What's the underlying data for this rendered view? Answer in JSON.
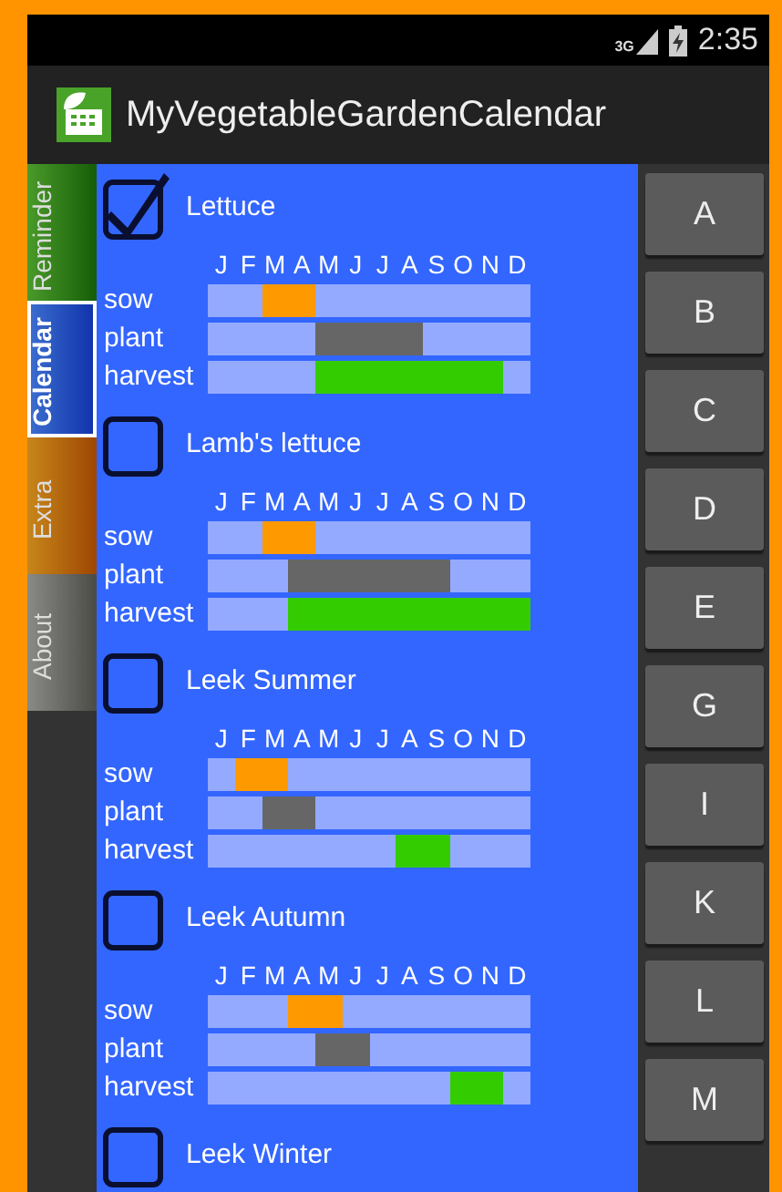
{
  "status_bar": {
    "network": "3G",
    "time": "2:35"
  },
  "action_bar": {
    "title": "MyVegetableGardenCalendar"
  },
  "side_tabs": [
    {
      "label": "Reminder",
      "selected": false,
      "color": "#4a9a2a"
    },
    {
      "label": "Calendar",
      "selected": true,
      "color": "#3d6fd0"
    },
    {
      "label": "Extra",
      "selected": false,
      "color": "#c8861a"
    },
    {
      "label": "About",
      "selected": false,
      "color": "#8a8a86"
    }
  ],
  "crops": [
    {
      "name": "Lettuce",
      "checked": true,
      "month_labels": [
        "J",
        "F",
        "M",
        "A",
        "M",
        "J",
        "J",
        "A",
        "S",
        "O",
        "N",
        "D"
      ],
      "rows": [
        {
          "label": "sow",
          "color": "#ff9900",
          "months": [
            false,
            false,
            true,
            true,
            false,
            false,
            false,
            false,
            false,
            false,
            false,
            false
          ]
        },
        {
          "label": "plant",
          "color": "#666666",
          "months": [
            false,
            false,
            false,
            false,
            true,
            true,
            true,
            true,
            false,
            false,
            false,
            false
          ]
        },
        {
          "label": "harvest",
          "color": "#33cc00",
          "months": [
            false,
            false,
            false,
            false,
            true,
            true,
            true,
            true,
            true,
            true,
            true,
            false
          ]
        }
      ]
    },
    {
      "name": "Lamb's lettuce",
      "checked": false,
      "month_labels": [
        "J",
        "F",
        "M",
        "A",
        "M",
        "J",
        "J",
        "A",
        "S",
        "O",
        "N",
        "D"
      ],
      "rows": [
        {
          "label": "sow",
          "color": "#ff9900",
          "months": [
            false,
            false,
            true,
            true,
            false,
            false,
            false,
            false,
            false,
            false,
            false,
            false
          ]
        },
        {
          "label": "plant",
          "color": "#666666",
          "months": [
            false,
            false,
            false,
            true,
            true,
            true,
            true,
            true,
            true,
            false,
            false,
            false
          ]
        },
        {
          "label": "harvest",
          "color": "#33cc00",
          "months": [
            false,
            false,
            false,
            true,
            true,
            true,
            true,
            true,
            true,
            true,
            true,
            true
          ]
        }
      ]
    },
    {
      "name": "Leek Summer",
      "checked": false,
      "month_labels": [
        "J",
        "F",
        "M",
        "A",
        "M",
        "J",
        "J",
        "A",
        "S",
        "O",
        "N",
        "D"
      ],
      "rows": [
        {
          "label": "sow",
          "color": "#ff9900",
          "months": [
            false,
            true,
            true,
            false,
            false,
            false,
            false,
            false,
            false,
            false,
            false,
            false
          ]
        },
        {
          "label": "plant",
          "color": "#666666",
          "months": [
            false,
            false,
            true,
            true,
            false,
            false,
            false,
            false,
            false,
            false,
            false,
            false
          ]
        },
        {
          "label": "harvest",
          "color": "#33cc00",
          "months": [
            false,
            false,
            false,
            false,
            false,
            false,
            false,
            true,
            true,
            false,
            false,
            false
          ]
        }
      ]
    },
    {
      "name": "Leek Autumn",
      "checked": false,
      "month_labels": [
        "J",
        "F",
        "M",
        "A",
        "M",
        "J",
        "J",
        "A",
        "S",
        "O",
        "N",
        "D"
      ],
      "rows": [
        {
          "label": "sow",
          "color": "#ff9900",
          "months": [
            false,
            false,
            false,
            true,
            true,
            false,
            false,
            false,
            false,
            false,
            false,
            false
          ]
        },
        {
          "label": "plant",
          "color": "#666666",
          "months": [
            false,
            false,
            false,
            false,
            true,
            true,
            false,
            false,
            false,
            false,
            false,
            false
          ]
        },
        {
          "label": "harvest",
          "color": "#33cc00",
          "months": [
            false,
            false,
            false,
            false,
            false,
            false,
            false,
            false,
            false,
            true,
            true,
            false
          ]
        }
      ]
    },
    {
      "name": "Leek Winter",
      "checked": false
    }
  ],
  "index_buttons": [
    "A",
    "B",
    "C",
    "D",
    "E",
    "G",
    "I",
    "K",
    "L",
    "M"
  ]
}
